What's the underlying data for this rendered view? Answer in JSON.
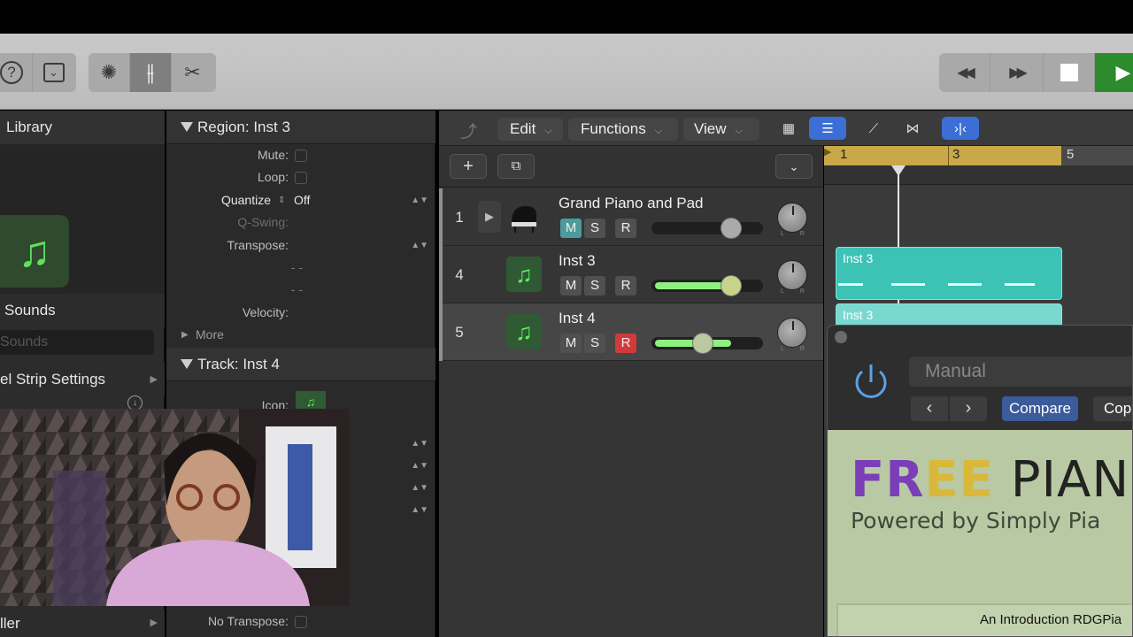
{
  "toolbar": {
    "left_buttons": [
      {
        "name": "help-icon",
        "glyph": "?"
      },
      {
        "name": "inbox-icon",
        "glyph": "⌄"
      }
    ],
    "mode_buttons": [
      {
        "name": "smart-controls-icon",
        "glyph": "✺"
      },
      {
        "name": "mixer-icon",
        "glyph": "⫲"
      },
      {
        "name": "scissors-icon",
        "glyph": "✂"
      }
    ],
    "transport": [
      {
        "name": "rewind-icon",
        "glyph": "◀◀"
      },
      {
        "name": "fast-forward-icon",
        "glyph": "▶▶"
      },
      {
        "name": "stop-icon",
        "glyph": "■"
      },
      {
        "name": "play-icon",
        "glyph": "▶"
      }
    ]
  },
  "library": {
    "title": "Library",
    "sounds_heading": "Sounds",
    "search_placeholder": "Sounds",
    "channel_strip": "el Strip Settings",
    "bottom_item": "ller"
  },
  "inspector": {
    "region_title": "Region: Inst 3",
    "region_rows": [
      {
        "label": "Mute:",
        "value": "",
        "type": "check"
      },
      {
        "label": "Loop:",
        "value": "",
        "type": "check"
      },
      {
        "label": "Quantize",
        "value": "Off",
        "type": "select"
      },
      {
        "label": "Q-Swing:",
        "value": "",
        "type": "text"
      },
      {
        "label": "Transpose:",
        "value": "",
        "type": "select"
      },
      {
        "label": "- -",
        "value": "",
        "type": "text"
      },
      {
        "label": "- -",
        "value": "",
        "type": "text"
      },
      {
        "label": "Velocity:",
        "value": "",
        "type": "text"
      }
    ],
    "more_label": "More",
    "track_title": "Track: Inst 4",
    "icon_label": "Icon:",
    "no_transpose_label": "No Transpose:"
  },
  "tracks_header": {
    "menus": [
      "Edit",
      "Functions",
      "View"
    ]
  },
  "tracks": [
    {
      "number": "1",
      "name": "Grand Piano and Pad",
      "icon": "piano-icon",
      "mute_on": true,
      "rec_on": false,
      "fader_level": 0.72
    },
    {
      "number": "4",
      "name": "Inst 3",
      "icon": "music-note-icon",
      "mute_on": false,
      "rec_on": false,
      "fader_level": 0.72
    },
    {
      "number": "5",
      "name": "Inst 4",
      "icon": "music-note-icon",
      "mute_on": false,
      "rec_on": true,
      "fader_level": 0.46
    }
  ],
  "msr_labels": {
    "mute": "M",
    "solo": "S",
    "record": "R"
  },
  "ruler": {
    "bars": [
      "1",
      "3",
      "5"
    ]
  },
  "regions": [
    {
      "label": "Inst 3"
    },
    {
      "label": "Inst 3"
    }
  ],
  "plugin": {
    "preset": "Manual",
    "compare_label": "Compare",
    "copy_label": "Cop",
    "title_parts": [
      "F",
      "R",
      "E",
      "E",
      " PIAN"
    ],
    "title_colors": [
      "#7a3fb8",
      "#7a3fb8",
      "#d9b83a",
      "#d9b83a",
      "#222222"
    ],
    "subtitle": "Powered by Simply Pia",
    "intro": "An Introduction RDGPia"
  }
}
